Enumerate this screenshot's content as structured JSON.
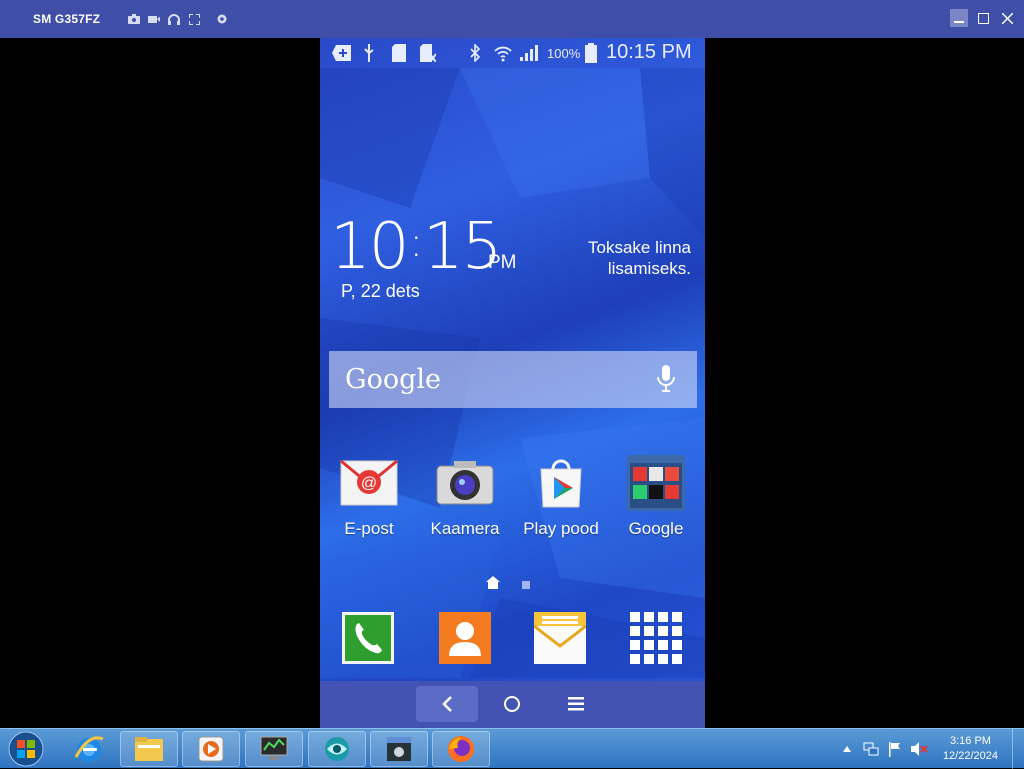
{
  "window": {
    "title": "SM G357FZ",
    "toolbar_icons": [
      "camera-icon",
      "video-icon",
      "headphones-icon",
      "fullscreen-icon",
      "settings-icon"
    ],
    "controls": [
      "minimize-icon",
      "maximize-icon",
      "close-icon"
    ]
  },
  "phone": {
    "statusbar": {
      "icons": [
        "add-icon",
        "usb-icon",
        "sd-card-icon",
        "sim-card-icon",
        "bluetooth-icon",
        "wifi-icon",
        "signal-icon",
        "battery-icon"
      ],
      "battery": "100%",
      "time": "10:15 PM"
    },
    "clock_widget": {
      "hours": "10",
      "minutes": "15",
      "ampm": "PM",
      "date": "P, 22 dets",
      "weather_line1": "Toksake linna",
      "weather_line2": "lisamiseks."
    },
    "search": {
      "logo": "Google",
      "icon": "mic-icon"
    },
    "apps": [
      {
        "label": "E-post",
        "icon": "email-icon"
      },
      {
        "label": "Kaamera",
        "icon": "camera-app-icon"
      },
      {
        "label": "Play pood",
        "icon": "play-store-icon"
      },
      {
        "label": "Google",
        "icon": "google-folder-icon"
      }
    ],
    "dock": [
      "phone-icon",
      "contacts-icon",
      "messages-icon",
      "apps-grid-icon"
    ],
    "navbar": [
      "back-icon",
      "home-icon",
      "menu-icon"
    ]
  },
  "taskbar": {
    "items": [
      "start-icon",
      "internet-explorer-icon",
      "file-explorer-icon",
      "media-player-icon",
      "network-monitor-icon",
      "screen-mirror-icon",
      "app-window-icon",
      "firefox-icon"
    ],
    "tray_icons": [
      "show-hidden-icon",
      "network-icon",
      "flag-icon",
      "volume-muted-icon"
    ],
    "time": "3:16 PM",
    "date": "12/22/2024"
  }
}
